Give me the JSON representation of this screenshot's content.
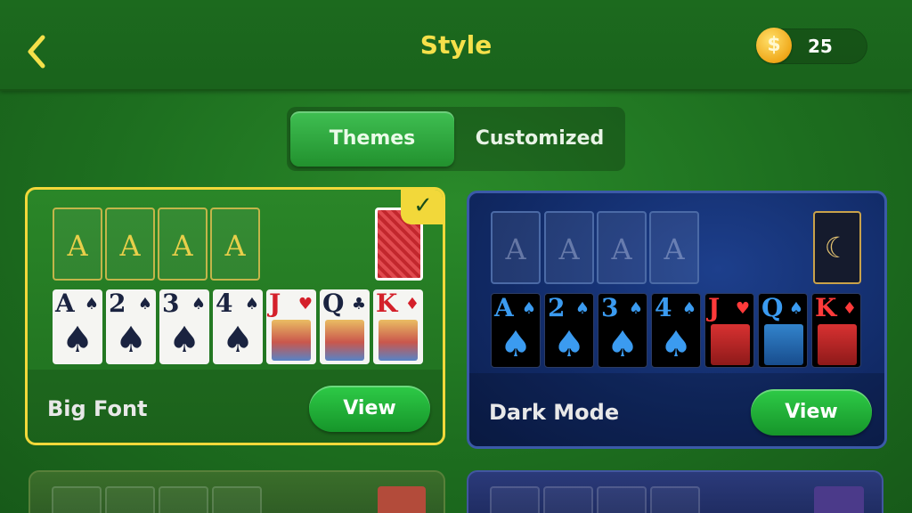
{
  "header": {
    "title": "Style",
    "coins": "25",
    "coin_symbol": "$"
  },
  "tabs": [
    {
      "label": "Themes",
      "selected": true
    },
    {
      "label": "Customized",
      "selected": false
    }
  ],
  "themes": [
    {
      "name": "Big Font",
      "button": "View",
      "selected": true,
      "check": "✓",
      "foundations": [
        "A",
        "A",
        "A",
        "A"
      ],
      "cards": [
        {
          "rank": "A",
          "suit": "♠",
          "color": "black",
          "face": false
        },
        {
          "rank": "2",
          "suit": "♠",
          "color": "black",
          "face": false
        },
        {
          "rank": "3",
          "suit": "♠",
          "color": "black",
          "face": false
        },
        {
          "rank": "4",
          "suit": "♠",
          "color": "black",
          "face": false
        },
        {
          "rank": "J",
          "suit": "♥",
          "color": "red",
          "face": true
        },
        {
          "rank": "Q",
          "suit": "♣",
          "color": "black",
          "face": true
        },
        {
          "rank": "K",
          "suit": "♦",
          "color": "red",
          "face": true
        }
      ]
    },
    {
      "name": "Dark Mode",
      "button": "View",
      "selected": false,
      "stock_symbol": "☾",
      "foundations": [
        "A",
        "A",
        "A",
        "A"
      ],
      "cards": [
        {
          "rank": "A",
          "suit": "♠",
          "color": "black",
          "face": false
        },
        {
          "rank": "2",
          "suit": "♠",
          "color": "black",
          "face": false
        },
        {
          "rank": "3",
          "suit": "♠",
          "color": "black",
          "face": false
        },
        {
          "rank": "4",
          "suit": "♠",
          "color": "black",
          "face": false
        },
        {
          "rank": "J",
          "suit": "♥",
          "color": "red",
          "face": true
        },
        {
          "rank": "Q",
          "suit": "♠",
          "color": "blueface",
          "face": true
        },
        {
          "rank": "K",
          "suit": "♦",
          "color": "red",
          "face": true
        }
      ]
    }
  ],
  "colors": {
    "title": "#f5e04a",
    "selected_border": "#f2d83a",
    "view_button": "#22b23a"
  }
}
